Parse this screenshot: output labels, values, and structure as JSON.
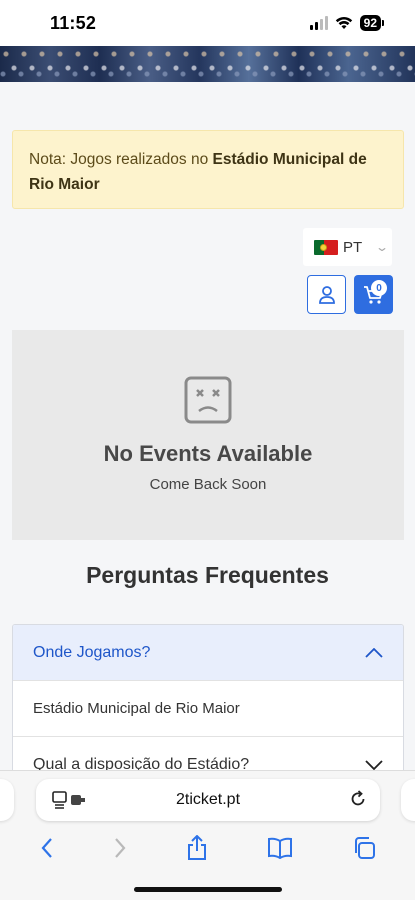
{
  "status_bar": {
    "time": "11:52",
    "battery": "92"
  },
  "notice": {
    "prefix": "Nota: Jogos realizados no ",
    "venue": "Estádio Municipal de Rio Maior"
  },
  "language": {
    "selected": "PT"
  },
  "cart": {
    "count": "0"
  },
  "empty_state": {
    "title": "No Events Available",
    "subtitle": "Come Back Soon"
  },
  "faq": {
    "title": "Perguntas Frequentes",
    "items": [
      {
        "question": "Onde Jogamos?",
        "answer": "Estádio Municipal de Rio Maior",
        "expanded": true
      },
      {
        "question": "Qual a disposição do Estádio?",
        "expanded": false
      }
    ]
  },
  "browser": {
    "url": "2ticket.pt"
  },
  "colors": {
    "accent": "#2e6de0",
    "notice_bg": "#fdf3cd",
    "empty_bg": "#e9e9e9",
    "faq_open_bg": "#e8eefc"
  }
}
